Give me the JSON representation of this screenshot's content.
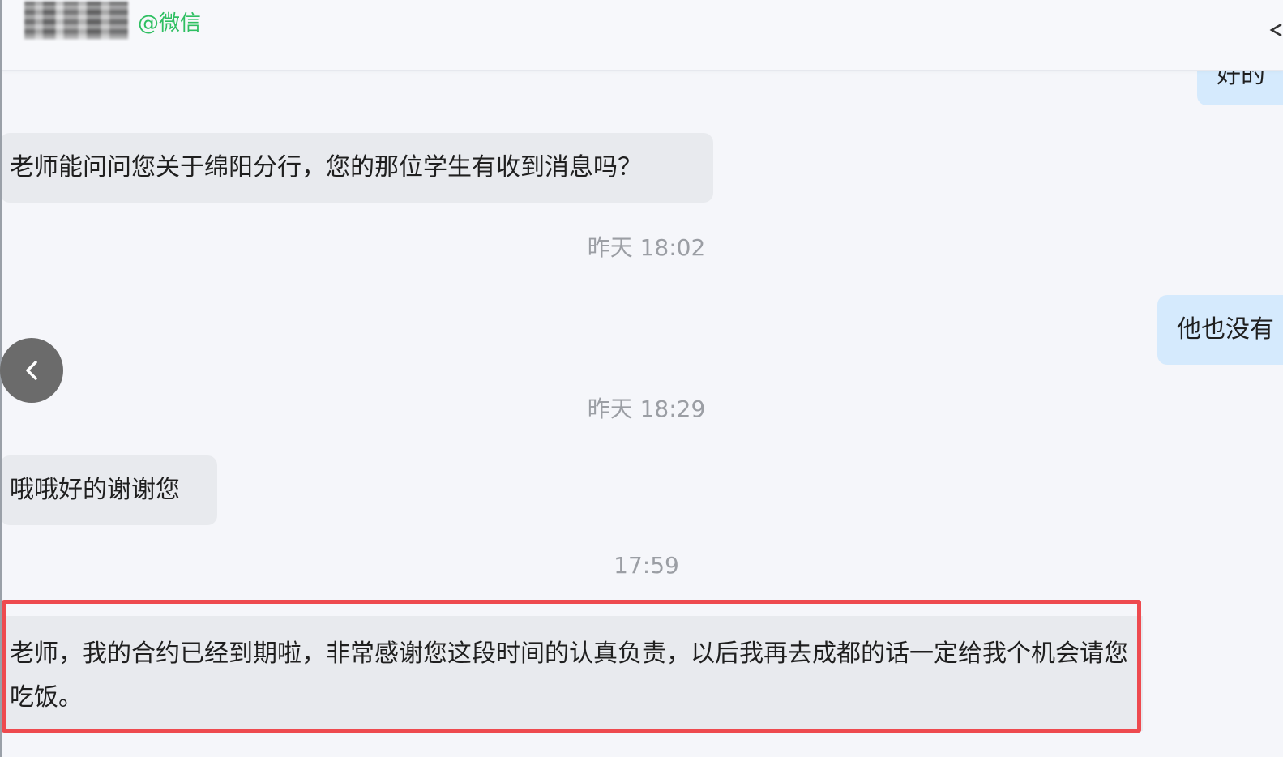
{
  "header": {
    "contact_suffix": "@微信"
  },
  "messages": [
    {
      "side": "out",
      "text": "好的"
    },
    {
      "side": "in",
      "text": "老师能问问您关于绵阳分行，您的那位学生有收到消息吗？"
    },
    {
      "timestamp": "昨天 18:02"
    },
    {
      "side": "out",
      "text": "他也没有"
    },
    {
      "timestamp": "昨天 18:29"
    },
    {
      "side": "in",
      "text": "哦哦好的谢谢您"
    },
    {
      "timestamp": "17:59"
    },
    {
      "side": "in",
      "text": "老师，我的合约已经到期啦，非常感谢您这段时间的认真负责，以后我再去成都的话一定给我个机会请您吃饭。"
    }
  ],
  "icons": {
    "back": "chevron-left-icon",
    "header_right": "chevron-icon"
  },
  "colors": {
    "incoming_bubble": "#e8eaee",
    "outgoing_bubble": "#d5eafd",
    "wechat_green": "#2fbf62",
    "highlight_border": "#ee4a4f"
  }
}
